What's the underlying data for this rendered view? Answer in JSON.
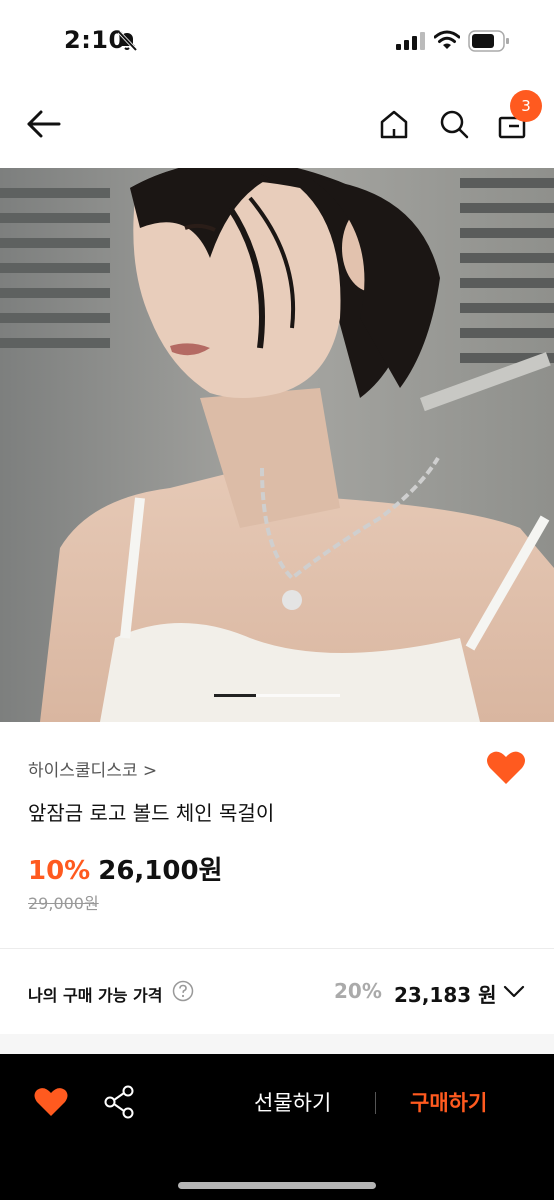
{
  "status_bar": {
    "time": "2:10"
  },
  "nav": {
    "cart_count": "3"
  },
  "product": {
    "brand": "하이스쿨디스코 >",
    "title": "앞잠금 로고 볼드 체인 목걸이",
    "discount": "10%",
    "price": "26,100원",
    "original_price": "29,000원"
  },
  "my_price": {
    "label": "나의 구매 가능 가격",
    "discount": "20%",
    "value": "23,183 원"
  },
  "bottom_bar": {
    "gift_label": "선물하기",
    "buy_label": "구매하기"
  },
  "colors": {
    "accent": "#ff5a1f",
    "bottom_bar": "#000000"
  },
  "icons": [
    "bell-slash-icon",
    "signal-icon",
    "wifi-icon",
    "battery-icon",
    "back-arrow-icon",
    "home-icon",
    "search-icon",
    "cart-icon",
    "heart-icon",
    "help-icon",
    "chevron-down-icon",
    "share-icon"
  ],
  "image_carousel": {
    "current_slide": 1,
    "total_slides": 3
  }
}
